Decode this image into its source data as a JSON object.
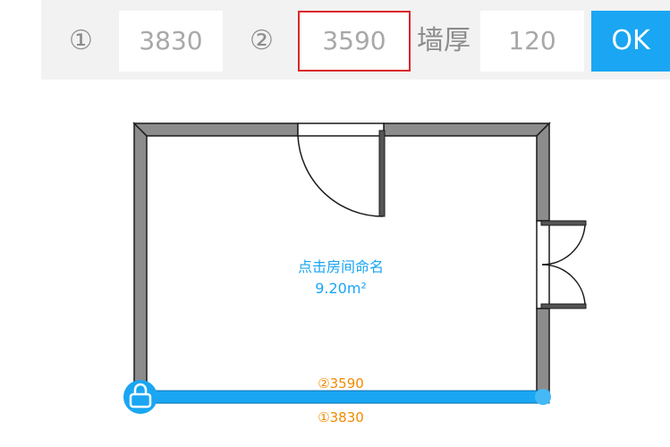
{
  "toolbar": {
    "label_1": "①",
    "value_1": "3830",
    "label_2": "②",
    "value_2": "3590",
    "thickness_label": "墙厚",
    "thickness_value": "120",
    "ok_label": "OK"
  },
  "room": {
    "name": "点击房间命名",
    "area": "9.20m²"
  },
  "dimensions": {
    "inner": "②3590",
    "outer": "①3830"
  },
  "colors": {
    "accent": "#1aa6f2",
    "active_border": "#d9262c",
    "dimension_text": "#f08a00",
    "wall_fill": "#8c8c8c"
  },
  "icons": {
    "lock": "lock-icon"
  }
}
